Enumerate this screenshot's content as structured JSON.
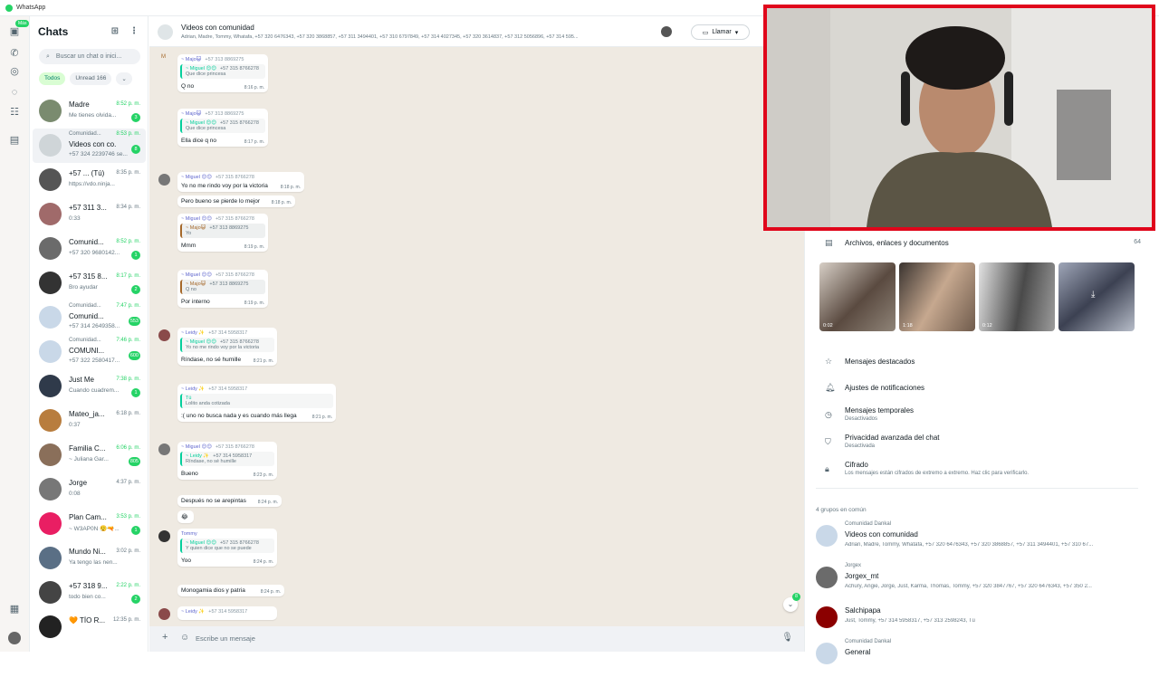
{
  "app": {
    "title": "WhatsApp"
  },
  "rail": {
    "badge": "Más"
  },
  "sidebar": {
    "title": "Chats",
    "search_placeholder": "Buscar un chat o inici...",
    "filters": [
      "Todos",
      "Unread 166"
    ],
    "chats": [
      {
        "name": "Madre",
        "preview": "Me tienes olvida...",
        "time": "8:52 p. m.",
        "badge": "3"
      },
      {
        "community": "Comunidad...",
        "name": "Videos con co...",
        "preview": "+57 324 2239746 se...",
        "time": "8:53 p. m.",
        "badge": "8"
      },
      {
        "name": "+57 ... (Tú)",
        "preview": "https://vdo.ninja...",
        "time": "8:35 p. m.",
        "badge": ""
      },
      {
        "name": "+57 311 3...",
        "preview": "0:33",
        "time": "8:34 p. m.",
        "badge": ""
      },
      {
        "name": "Comunid...",
        "preview": "+57 320 9680142...",
        "time": "8:52 p. m.",
        "badge": "1"
      },
      {
        "name": "+57 315 8...",
        "preview": "Bro ayudar",
        "time": "8:17 p. m.",
        "badge": "2"
      },
      {
        "community": "Comunidad...",
        "name": "Comunid...",
        "preview": "+57 314 2649358...",
        "time": "7:47 p. m.",
        "badge": "553"
      },
      {
        "community": "Comunidad...",
        "name": "COMUNI...",
        "preview": "+57 322 2580417...",
        "time": "7:46 p. m.",
        "badge": "600"
      },
      {
        "name": "Just Me",
        "preview": "Cuando cuadrem...",
        "time": "7:38 p. m.",
        "badge": "1"
      },
      {
        "name": "Mateo_ja...",
        "preview": "0:37",
        "time": "6:18 p. m.",
        "badge": ""
      },
      {
        "name": "Familia C...",
        "preview": "~ Juliana Gar...",
        "time": "6:06 p. m.",
        "badge": "805"
      },
      {
        "name": "Jorge",
        "preview": "0:08",
        "time": "4:37 p. m.",
        "badge": ""
      },
      {
        "name": "Plan Cam...",
        "preview": "~ W3AP0N 😮‍💨🔫...",
        "time": "3:53 p. m.",
        "badge": "1"
      },
      {
        "name": "Mundo Ni...",
        "preview": "Ya tengo las nen...",
        "time": "3:02 p. m.",
        "badge": ""
      },
      {
        "name": "+57 318 9...",
        "preview": "todo bien co...",
        "time": "2:22 p. m.",
        "badge": "2"
      },
      {
        "name": "🧡 TÍO R...",
        "preview": "",
        "time": "12:35 p. m.",
        "badge": ""
      }
    ]
  },
  "conversation": {
    "title": "Videos con comunidad",
    "members": "Adrian, Madre, Tommy, Whatafa, +57 320 6476343, +57 320 3868857, +57 311 3494401, +57 310 6797849, +57 314 4027345, +57 320 3614837, +57 312 5056896, +57 314 595...",
    "call_label": "Llamar",
    "compose_placeholder": "Escribe un mensaje",
    "unread_scroll": "8",
    "messages": [
      {
        "sender": "~ Majo😺",
        "phone": "+57 313 8869275",
        "quote_name": "~ Miguel 😊😊",
        "quote_phone": "+57 315 8766278",
        "quote_text": "Que dice princesa",
        "text": "Q no",
        "time": "8:16 p. m."
      },
      {
        "sender": "~ Majo😺",
        "phone": "+57 313 8869275",
        "quote_name": "~ Miguel 😊😊",
        "quote_phone": "+57 315 8766278",
        "quote_text": "Que dice princesa",
        "text": "Ella dice q no",
        "time": "8:17 p. m."
      },
      {
        "sender": "~ Miguel 😊😊",
        "phone": "+57 315 8766278",
        "text": "Yo no me rindo voy por la victoria",
        "time": "8:18 p. m."
      },
      {
        "text": "Pero bueno se pierde lo mejor",
        "time": "8:18 p. m."
      },
      {
        "sender": "~ Miguel 😊😊",
        "phone": "+57 315 8766278",
        "quote_name": "~ Majo😺",
        "quote_phone": "+57 313 8869275",
        "quote_text": "Yo",
        "text": "Mmm",
        "time": "8:19 p. m."
      },
      {
        "sender": "~ Miguel 😊😊",
        "phone": "+57 315 8766278",
        "quote_name": "~ Majo😺",
        "quote_phone": "+57 313 8869275",
        "quote_text": "Q no",
        "text": "Por interno",
        "time": "8:19 p. m."
      },
      {
        "sender": "~ Leidy ✨",
        "phone": "+57 314 5958317",
        "quote_name": "~ Miguel 😊😊",
        "quote_phone": "+57 315 8766278",
        "quote_text": "Yo no me rindo voy por la victoria",
        "text": "Ríndase, no sé humille",
        "time": "8:21 p. m."
      },
      {
        "sender": "~ Leidy ✨",
        "phone": "+57 314 5958317",
        "quote_name": "Tú",
        "quote_phone": "",
        "quote_text": "Lolito anda cotizada",
        "text": ":( uno no busca nada y es cuando más llega",
        "time": "8:21 p. m."
      },
      {
        "sender": "~ Miguel 😊😊",
        "phone": "+57 315 8766278",
        "quote_name": "~ Leidy ✨",
        "quote_phone": "+57 314 5958317",
        "quote_text": "Ríndase, no sé humille",
        "text": "Bueno",
        "time": "8:23 p. m."
      },
      {
        "text": "Después no se arepintas",
        "time": "8:24 p. m."
      },
      {
        "text": "😂",
        "time": ""
      },
      {
        "sender": "Tommy",
        "phone": "",
        "quote_name": "~ Miguel 😊😊",
        "quote_phone": "+57 315 8766278",
        "quote_text": "Y quien dice que no se puede",
        "text": "Yoo",
        "time": "8:24 p. m."
      },
      {
        "text": "Monogamia dios y patria",
        "time": "8:24 p. m."
      },
      {
        "sender": "~ Leidy ✨",
        "phone": "+57 314 5958317",
        "text": "",
        "time": ""
      }
    ]
  },
  "info": {
    "media_label": "Archivos, enlaces y documentos",
    "media_count": "64",
    "thumbs": [
      "0:02",
      "1:18",
      "0:12",
      ""
    ],
    "starred": "Mensajes destacados",
    "notifications": "Ajustes de notificaciones",
    "temporary": {
      "title": "Mensajes temporales",
      "sub": "Desactivados"
    },
    "privacy": {
      "title": "Privacidad avanzada del chat",
      "sub": "Desactivada"
    },
    "encryption": {
      "title": "Cifrado",
      "sub": "Los mensajes están cifrados de extremo a extremo. Haz clic para verificarlo."
    },
    "common_groups_label": "4 grupos en común",
    "groups": [
      {
        "community": "Comunidad Dankal",
        "name": "Videos con comunidad",
        "members": "Adrian, Madre, Tommy, Whatafa, +57 320 6476343, +57 320 3868857, +57 311 3494401, +57 310 67..."
      },
      {
        "community": "Jorgex",
        "name": "Jorgex_mt",
        "members": "Achury, Angie, Jorge, Just, Karma, Thomas, Tommy, +57 320 3847767, +57 320 6476343, +57 350 2..."
      },
      {
        "community": "",
        "name": "Salchipapa",
        "members": "Just, Tommy, +57 314 5958317, +57 313 2598243, Tú"
      },
      {
        "community": "Comunidad Dankal",
        "name": "General",
        "members": ""
      }
    ]
  },
  "colors": {
    "accent": "#25d366",
    "webcam_border": "#e0061b",
    "chat_bg": "#efeae2"
  }
}
